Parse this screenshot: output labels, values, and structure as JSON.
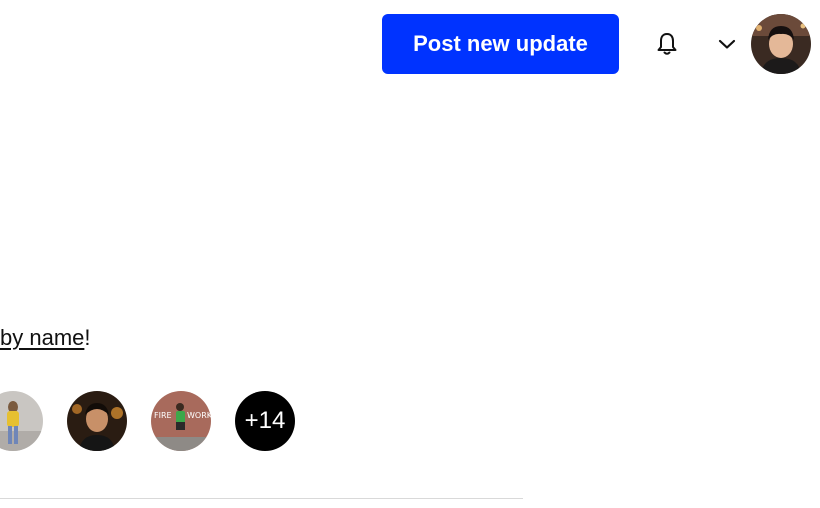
{
  "header": {
    "post_button_label": "Post new update",
    "notifications_icon": "bell-icon",
    "menu_icon": "chevron-down-icon"
  },
  "content": {
    "link_text": "by name",
    "trailing_text": "!"
  },
  "avatars": {
    "more_count": "+14"
  },
  "colors": {
    "primary": "#0033ff",
    "more_badge_bg": "#000000",
    "divider": "#d9d9d9"
  }
}
